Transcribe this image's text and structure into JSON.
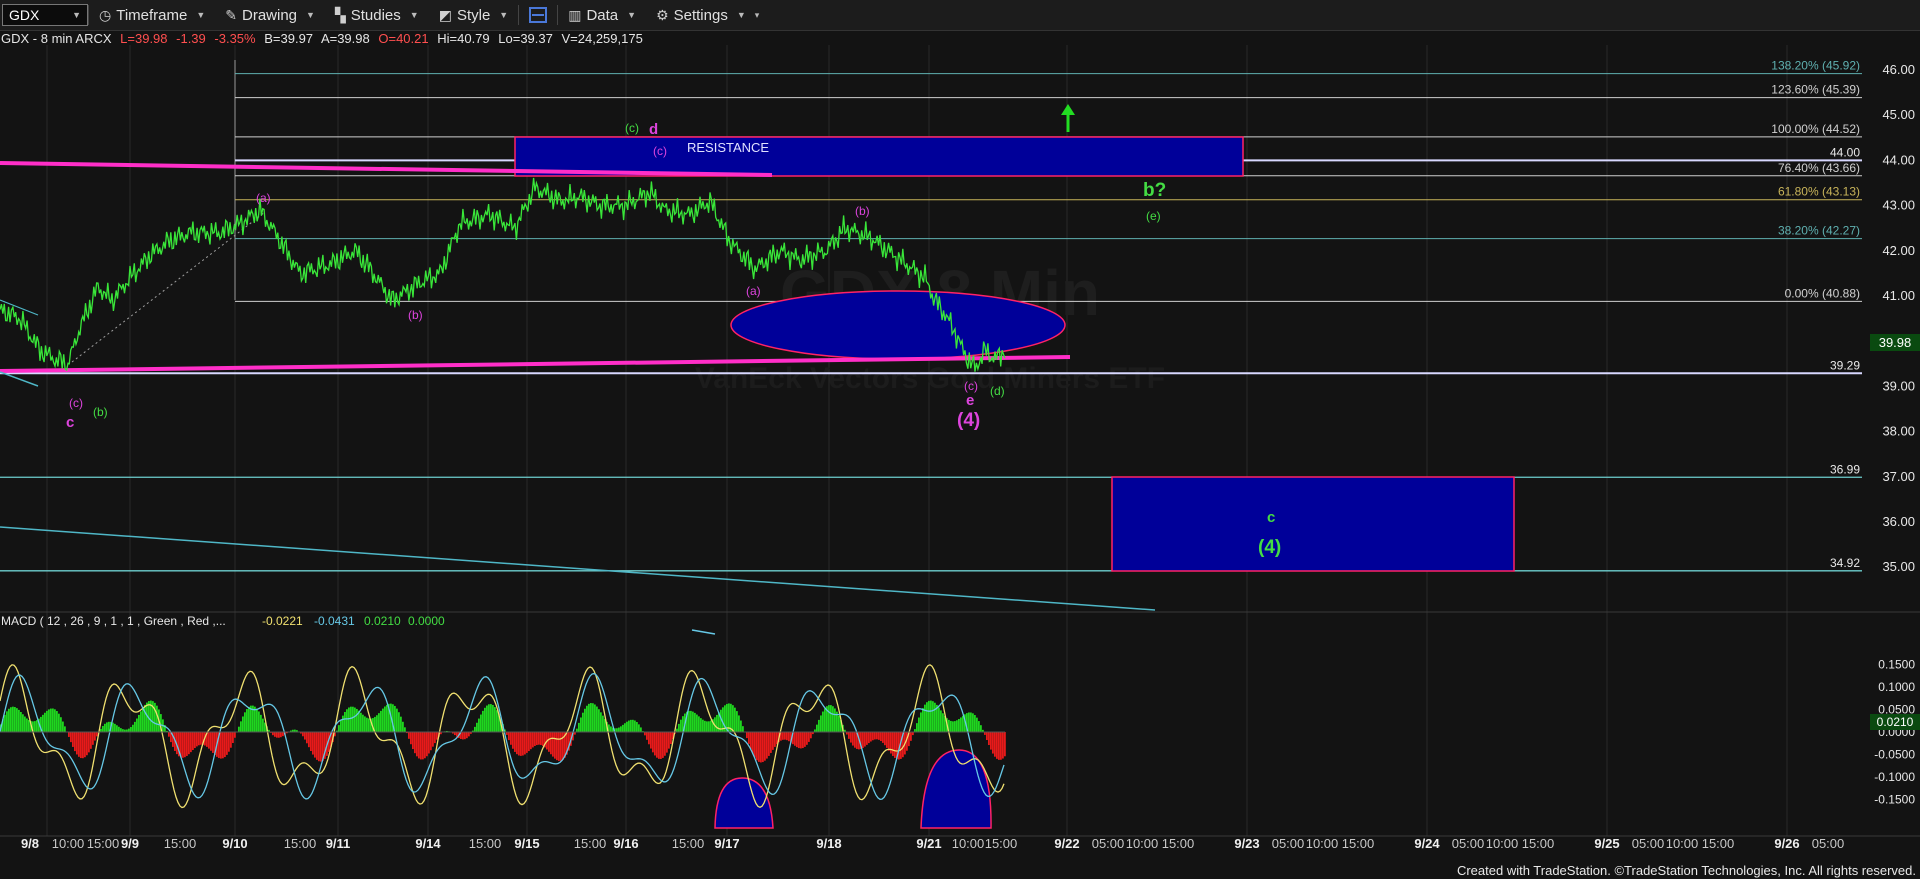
{
  "toolbar": {
    "symbol": "GDX",
    "items": [
      {
        "label": "Timeframe",
        "icon": "clock-icon"
      },
      {
        "label": "Drawing",
        "icon": "pencil-icon"
      },
      {
        "label": "Studies",
        "icon": "studies-icon"
      },
      {
        "label": "Style",
        "icon": "style-icon"
      },
      {
        "label": "Data",
        "icon": "data-icon"
      },
      {
        "label": "Settings",
        "icon": "gear-icon"
      }
    ]
  },
  "infobar": {
    "title": "GDX - 8 min  ARCX",
    "last": "L=39.98",
    "change": "-1.39",
    "pct": "-3.35%",
    "bid": "B=39.97",
    "ask": "A=39.98",
    "open": "O=40.21",
    "high": "Hi=40.79",
    "low": "Lo=39.37",
    "volume": "V=24,259,175"
  },
  "watermark": {
    "line1": "GDX 8 Min",
    "line2": "VanEck Vectors Gold Miners ETF"
  },
  "price_axis": {
    "ticks": [
      "46.00",
      "45.00",
      "44.00",
      "43.00",
      "42.00",
      "41.00",
      "40.00",
      "39.00",
      "38.00",
      "37.00",
      "36.00",
      "35.00"
    ],
    "last_price": "39.98"
  },
  "fib_levels": [
    {
      "label": "138.20% (45.92)",
      "price": 45.92,
      "color": "#5fb0b0"
    },
    {
      "label": "123.60% (45.39)",
      "price": 45.39,
      "color": "#d0d0d0"
    },
    {
      "label": "100.00% (44.52)",
      "price": 44.52,
      "color": "#d0d0d0"
    },
    {
      "label": "76.40% (43.66)",
      "price": 43.66,
      "color": "#d0d0d0"
    },
    {
      "label": "61.80% (43.13)",
      "price": 43.13,
      "color": "#c8b45a"
    },
    {
      "label": "38.20% (42.27)",
      "price": 42.27,
      "color": "#5fb0b0"
    },
    {
      "label": "0.00% (40.88)",
      "price": 40.88,
      "color": "#d0d0d0"
    }
  ],
  "h_levels": [
    {
      "label": "44.00",
      "price": 44.0,
      "color": "#d8d8ff"
    },
    {
      "label": "39.29",
      "price": 39.29,
      "color": "#d8d8ff"
    },
    {
      "label": "36.99",
      "price": 36.99,
      "color": "#6ecfcf"
    },
    {
      "label": "34.92",
      "price": 34.92,
      "color": "#6ecfcf"
    }
  ],
  "annotations": {
    "resistance": "RESISTANCE",
    "wave_labels": [
      {
        "text": "(c)",
        "color": "#dd44dd"
      },
      {
        "text": "(b)",
        "color": "#44dd44"
      },
      {
        "text": "c",
        "color": "#dd44dd"
      },
      {
        "text": "(a)",
        "color": "#dd44dd"
      },
      {
        "text": "(b)",
        "color": "#dd44dd"
      },
      {
        "text": "(c)",
        "color": "#44dd44"
      },
      {
        "text": "d",
        "color": "#dd44dd"
      },
      {
        "text": "(c)",
        "color": "#dd44dd"
      },
      {
        "text": "(a)",
        "color": "#dd44dd"
      },
      {
        "text": "(b)",
        "color": "#dd44dd"
      },
      {
        "text": "(c)",
        "color": "#dd44dd"
      },
      {
        "text": "e",
        "color": "#dd44dd"
      },
      {
        "text": "(d)",
        "color": "#44dd44"
      },
      {
        "text": "(4)",
        "color": "#dd44dd"
      },
      {
        "text": "b?",
        "color": "#44dd44"
      },
      {
        "text": "(e)",
        "color": "#44dd44"
      },
      {
        "text": "c",
        "color": "#44dd44"
      },
      {
        "text": "(4)",
        "color": "#44dd44"
      }
    ]
  },
  "macd": {
    "label": "MACD ( 12 , 26 , 9 , 1 , 1 , Green , Red ,...",
    "v1": "-0.0221",
    "v2": "-0.0431",
    "v3": "0.0210",
    "v4": "0.0000",
    "ticks": [
      "0.1500",
      "0.1000",
      "0.0500",
      "0.0000",
      "-0.0500",
      "-0.1000",
      "-0.1500"
    ],
    "last_value": "0.0210"
  },
  "time_axis": [
    "9/8",
    "10:00",
    "15:00",
    "9/9",
    "15:00",
    "9/10",
    "15:00",
    "9/11",
    "9/14",
    "15:00",
    "9/15",
    "15:00",
    "9/16",
    "15:00",
    "9/17",
    "9/18",
    "9/21",
    "10:00",
    "15:00",
    "9/22",
    "05:00",
    "10:00",
    "15:00",
    "9/23",
    "05:00",
    "10:00",
    "15:00",
    "9/24",
    "05:00",
    "10:00",
    "15:00",
    "9/25",
    "05:00",
    "10:00",
    "15:00",
    "9/26",
    "05:00"
  ],
  "footer": "Created with TradeStation. ©TradeStation Technologies, Inc. All rights reserved.",
  "chart_data": {
    "type": "line",
    "title": "GDX - 8 min ARCX",
    "x": [
      "9/8",
      "9/9",
      "9/10",
      "9/11",
      "9/14",
      "9/15",
      "9/16",
      "9/17",
      "9/18",
      "9/21"
    ],
    "series": [
      {
        "name": "GDX",
        "values": [
          40.7,
          41.8,
          42.9,
          41.4,
          41.9,
          43.4,
          43.2,
          42.4,
          42.5,
          39.98
        ]
      }
    ],
    "ylim": [
      34.5,
      46.2
    ],
    "colors": {
      "price": "#39e639",
      "macd_pos": "#1fd61f",
      "macd_neg": "#e81a1a",
      "macd_line": "#f0e070",
      "signal_line": "#66c8e6",
      "zone": "#000099",
      "zone_border": "#ff2266"
    }
  }
}
